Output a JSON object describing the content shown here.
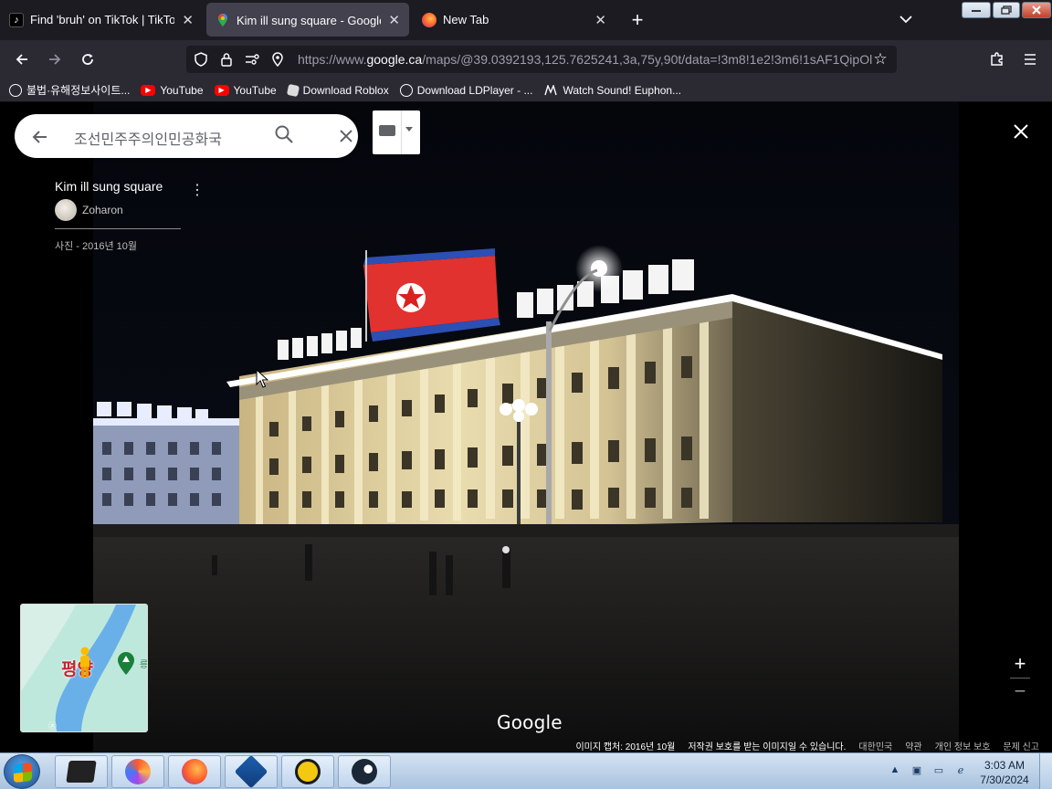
{
  "browser": {
    "tabs": [
      {
        "title": "Find 'bruh' on TikTok | TikTok S",
        "icon": "tiktok-icon",
        "active": false
      },
      {
        "title": "Kim ill sung square - Google 지",
        "icon": "google-maps-icon",
        "active": true
      },
      {
        "title": "New Tab",
        "icon": "firefox-icon",
        "active": false
      }
    ],
    "new_tab_symbol": "+",
    "address": {
      "prefix": "https://www.",
      "host": "google.ca",
      "path": "/maps/@39.0392193,125.7625241,3a,75y,90t/data=!3m8!1e2!3m6!1sAF1QipOl"
    },
    "bookmarks": [
      {
        "label": "불법·유해정보사이트...",
        "icon": "globe-icon"
      },
      {
        "label": "YouTube",
        "icon": "youtube-icon"
      },
      {
        "label": "YouTube",
        "icon": "youtube-icon"
      },
      {
        "label": "Download Roblox",
        "icon": "roblox-icon"
      },
      {
        "label": "Download LDPlayer - ...",
        "icon": "globe-icon"
      },
      {
        "label": "Watch Sound! Euphon...",
        "icon": "site-icon"
      }
    ]
  },
  "maps": {
    "search": {
      "value": "조선민주주의인민공화국"
    },
    "place": {
      "title": "Kim ill sung square",
      "author": "Zoharon",
      "date": "사진 - 2016년 10월"
    },
    "minimap": {
      "city_label": "평양",
      "side_label": "릉",
      "corner_label": "㉨"
    },
    "zoom": {
      "in": "+",
      "out": "−"
    },
    "logo": "Google",
    "footer": {
      "capture": "이미지 캡처: 2016년 10월",
      "copyright": "저작권 보호를 받는 이미지일 수 있습니다.",
      "country": "대한민국",
      "terms": "약관",
      "privacy": "개인 정보 보호",
      "report": "문제 신고"
    }
  },
  "taskbar": {
    "apps": [
      "terminal-icon",
      "app-swirl-icon",
      "firefox-icon",
      "virtualbox-icon",
      "teamviewer-icon",
      "steam-icon"
    ],
    "time": "3:03 AM",
    "date": "7/30/2024"
  }
}
